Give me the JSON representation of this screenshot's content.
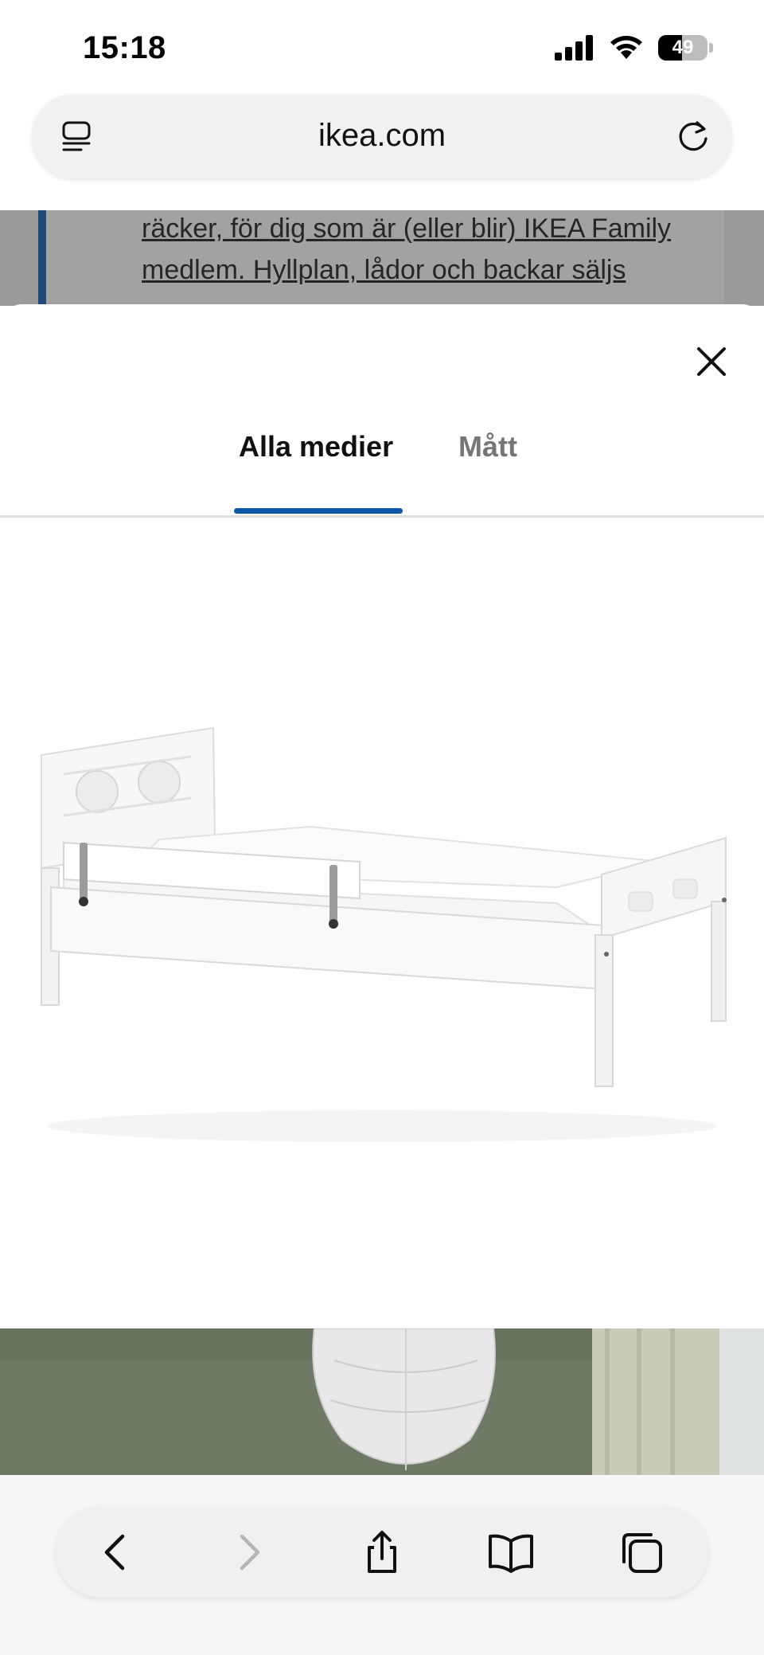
{
  "status_bar": {
    "time": "15:18",
    "battery_level": "49",
    "icons": [
      "cellular-signal-icon",
      "wifi-icon",
      "battery-icon"
    ]
  },
  "browser": {
    "url": "ikea.com",
    "left_icon": "page-menu-icon",
    "right_icon": "reload-icon"
  },
  "background_page": {
    "lines": [
      "räcker, för dig som är (eller blir) IKEA Family",
      "medlem. Hyllplan, lådor och backar säljs"
    ]
  },
  "modal": {
    "close_icon": "close-icon",
    "tabs": [
      {
        "label": "Alla medier",
        "active": true
      },
      {
        "label": "Mått",
        "active": false
      }
    ],
    "active_tab_color": "#0f58a8"
  },
  "toolbar": {
    "buttons": [
      "back-icon",
      "forward-icon",
      "share-icon",
      "bookmarks-icon",
      "tabs-icon"
    ]
  }
}
